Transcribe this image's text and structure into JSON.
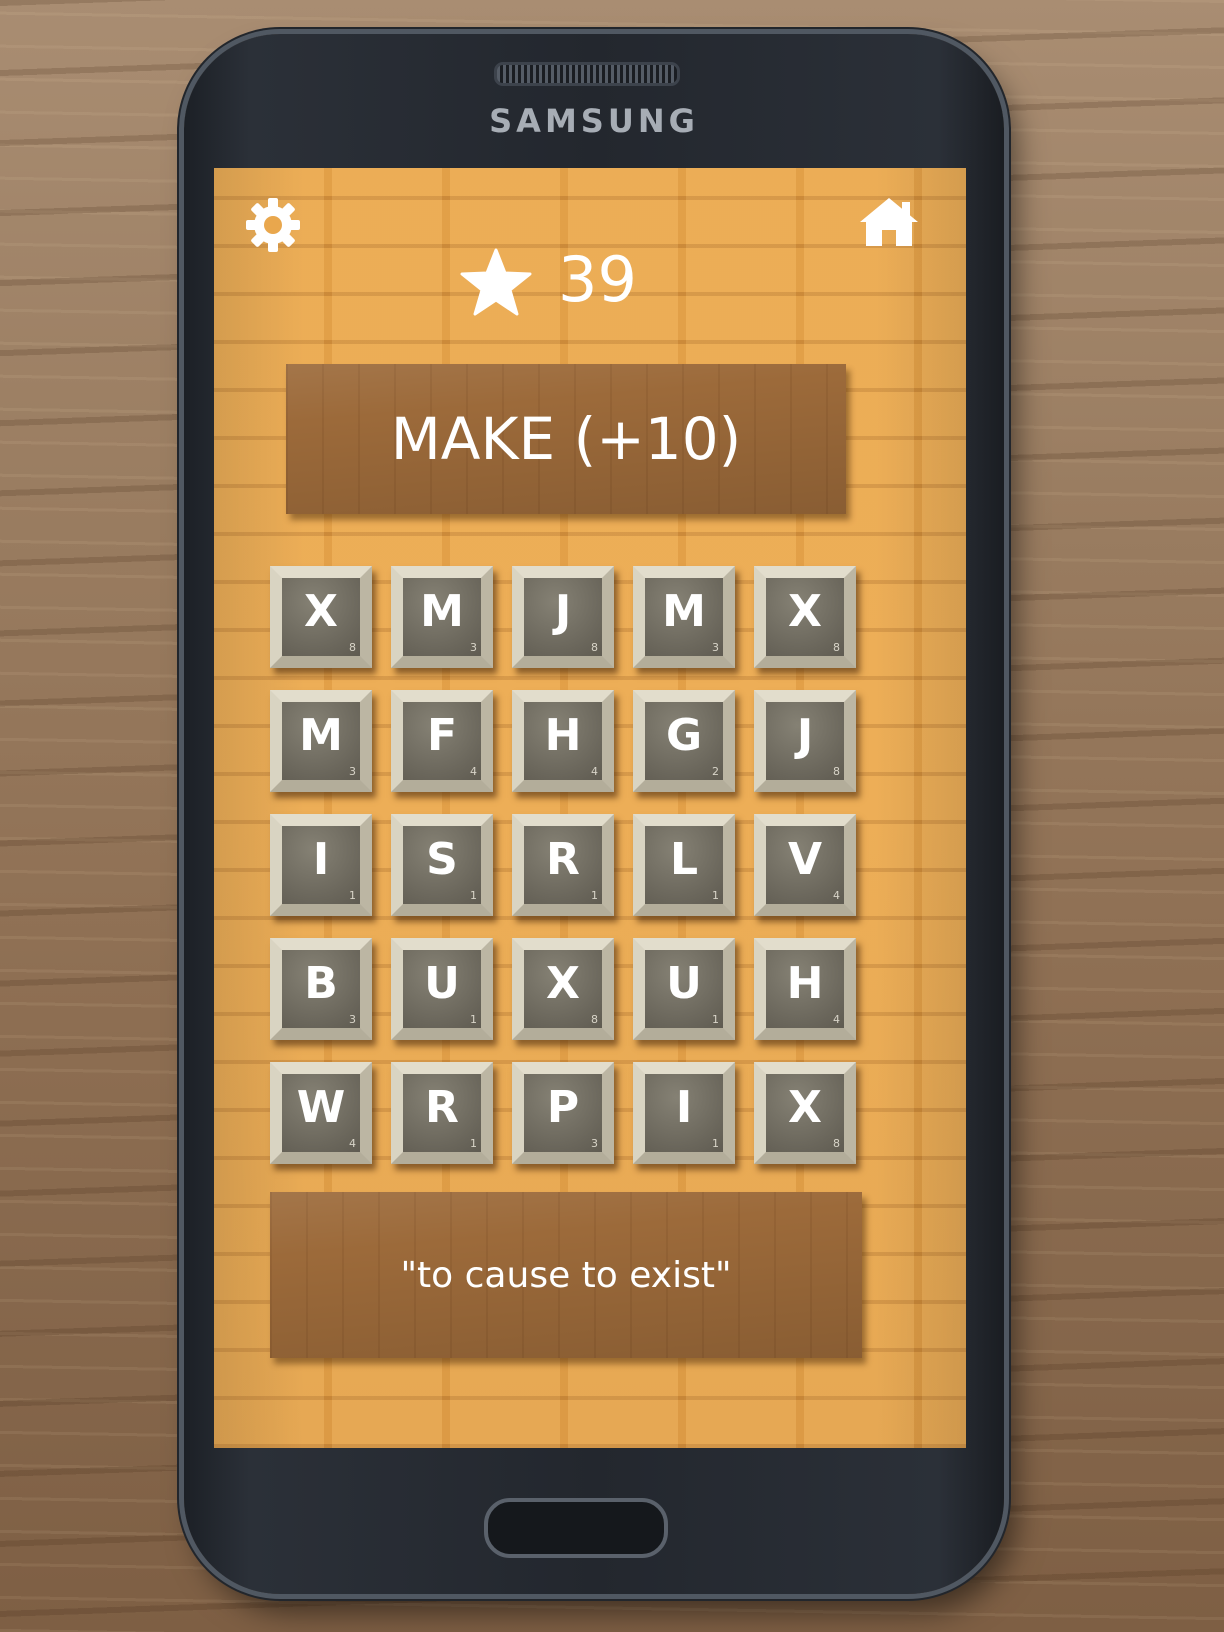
{
  "device": {
    "brand": "SAMSUNG"
  },
  "toolbar": {
    "settings_icon": "gear-icon",
    "home_icon": "house-icon"
  },
  "score": {
    "icon": "star-icon",
    "value": "39"
  },
  "make_button": {
    "label": "MAKE (+10)"
  },
  "hint": {
    "text": "\"to cause to exist\""
  },
  "board": {
    "rows": [
      [
        {
          "letter": "X",
          "points": "8"
        },
        {
          "letter": "M",
          "points": "3"
        },
        {
          "letter": "J",
          "points": "8"
        },
        {
          "letter": "M",
          "points": "3"
        },
        {
          "letter": "X",
          "points": "8"
        }
      ],
      [
        {
          "letter": "M",
          "points": "3"
        },
        {
          "letter": "F",
          "points": "4"
        },
        {
          "letter": "H",
          "points": "4"
        },
        {
          "letter": "G",
          "points": "2"
        },
        {
          "letter": "J",
          "points": "8"
        }
      ],
      [
        {
          "letter": "I",
          "points": "1"
        },
        {
          "letter": "S",
          "points": "1"
        },
        {
          "letter": "R",
          "points": "1"
        },
        {
          "letter": "L",
          "points": "1"
        },
        {
          "letter": "V",
          "points": "4"
        }
      ],
      [
        {
          "letter": "B",
          "points": "3"
        },
        {
          "letter": "U",
          "points": "1"
        },
        {
          "letter": "X",
          "points": "8"
        },
        {
          "letter": "U",
          "points": "1"
        },
        {
          "letter": "H",
          "points": "4"
        }
      ],
      [
        {
          "letter": "W",
          "points": "4"
        },
        {
          "letter": "R",
          "points": "1"
        },
        {
          "letter": "P",
          "points": "3"
        },
        {
          "letter": "I",
          "points": "1"
        },
        {
          "letter": "X",
          "points": "8"
        }
      ]
    ]
  }
}
